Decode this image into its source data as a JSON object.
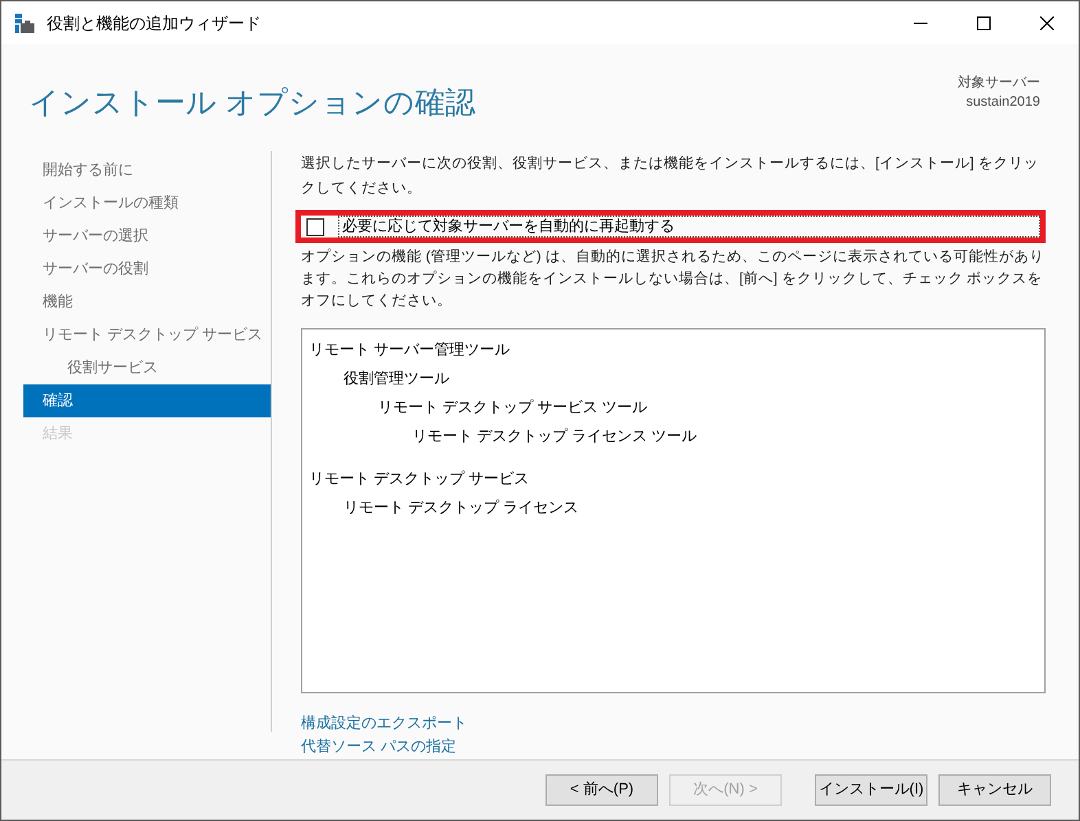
{
  "window": {
    "title": "役割と機能の追加ウィザード"
  },
  "header": {
    "title": "インストール オプションの確認",
    "server_label": "対象サーバー",
    "server_name": "sustain2019"
  },
  "sidebar": {
    "items": [
      {
        "label": "開始する前に",
        "selected": false,
        "disabled": false
      },
      {
        "label": "インストールの種類",
        "selected": false,
        "disabled": false
      },
      {
        "label": "サーバーの選択",
        "selected": false,
        "disabled": false
      },
      {
        "label": "サーバーの役割",
        "selected": false,
        "disabled": false
      },
      {
        "label": "機能",
        "selected": false,
        "disabled": false
      },
      {
        "label": "リモート デスクトップ サービス",
        "selected": false,
        "disabled": false,
        "children": [
          {
            "label": "役割サービス",
            "selected": false,
            "disabled": false
          }
        ]
      },
      {
        "label": "確認",
        "selected": true,
        "disabled": false
      },
      {
        "label": "結果",
        "selected": false,
        "disabled": true
      }
    ]
  },
  "intro": "選択したサーバーに次の役割、役割サービス、または機能をインストールするには、[インストール] をクリックしてください。",
  "restart_checkbox": {
    "label": "必要に応じて対象サーバーを自動的に再起動する",
    "checked": false,
    "highlighted": true
  },
  "note": "オプションの機能 (管理ツールなど) は、自動的に選択されるため、このページに表示されている可能性があります。これらのオプションの機能をインストールしない場合は、[前へ] をクリックして、チェック ボックスをオフにしてください。",
  "tree": [
    {
      "label": "リモート サーバー管理ツール",
      "children": [
        {
          "label": "役割管理ツール",
          "children": [
            {
              "label": "リモート デスクトップ サービス ツール",
              "children": [
                {
                  "label": "リモート デスクトップ ライセンス ツール"
                }
              ]
            }
          ]
        }
      ]
    },
    {
      "label": "リモート デスクトップ サービス",
      "children": [
        {
          "label": "リモート デスクトップ ライセンス"
        }
      ]
    }
  ],
  "links": [
    "構成設定のエクスポート",
    "代替ソース パスの指定"
  ],
  "buttons": [
    {
      "label": "< 前へ(P)",
      "disabled": false
    },
    {
      "label": "次へ(N) >",
      "disabled": true
    },
    {
      "label": "インストール(I)",
      "disabled": false
    },
    {
      "label": "キャンセル",
      "disabled": false
    }
  ]
}
